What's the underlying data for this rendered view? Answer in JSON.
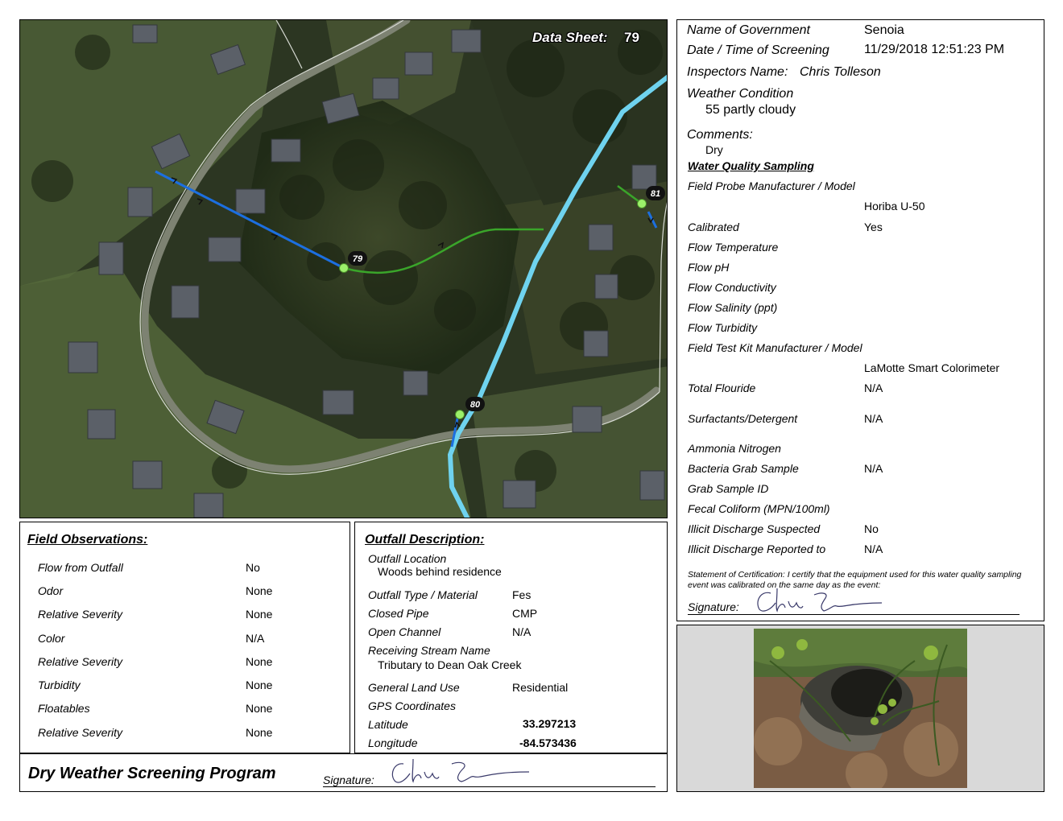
{
  "map": {
    "data_sheet_label": "Data Sheet:",
    "data_sheet_number": "79",
    "markers": [
      {
        "id": "79"
      },
      {
        "id": "80"
      },
      {
        "id": "81"
      }
    ],
    "colors": {
      "pipe": "#1c6fe0",
      "stream": "#6fd3ef",
      "channel": "#3aa52a",
      "outfall": "#9cf06a",
      "road": "#c9ccc6"
    }
  },
  "info": {
    "gov_label": "Name of Government",
    "gov_value": "Senoia",
    "date_label": "Date / Time of Screening",
    "date_value": "11/29/2018 12:51:23 PM",
    "inspectors_label": "Inspectors Name:",
    "inspectors_value": "Chris Tolleson",
    "weather_label": "Weather Condition",
    "weather_value": "55 partly cloudy",
    "comments_label": "Comments:",
    "comments_value": "Dry",
    "wq_title": "Water Quality Sampling",
    "probe_label": "Field Probe Manufacturer / Model",
    "probe_value": "Horiba U-50",
    "calibrated_label": "Calibrated",
    "calibrated_value": "Yes",
    "temp_label": "Flow Temperature",
    "ph_label": "Flow pH",
    "cond_label": "Flow Conductivity",
    "sal_label": "Flow Salinity (ppt)",
    "turb_label": "Flow Turbidity",
    "kit_label": "Field Test Kit Manufacturer / Model",
    "kit_value": "LaMotte Smart Colorimeter",
    "fluoride_label": "Total Flouride",
    "fluoride_value": "N/A",
    "surf_label": "Surfactants/Detergent",
    "surf_value": "N/A",
    "ammonia_label": "Ammonia Nitrogen",
    "bact_label": "Bacteria Grab Sample",
    "bact_value": "N/A",
    "grab_label": "Grab Sample ID",
    "fecal_label": "Fecal Coliform (MPN/100ml)",
    "suspected_label": "Illicit Discharge Suspected",
    "suspected_value": "No",
    "reported_label": "Illicit Discharge Reported to",
    "reported_value": "N/A",
    "certification": "Statement of Certification: I certify that the equipment used for this water quality sampling event was calibrated on the same day as the event:",
    "signature_label": "Signature:"
  },
  "field": {
    "title": "Field Observations:",
    "rows": [
      {
        "label": "Flow from Outfall",
        "value": "No"
      },
      {
        "label": "Odor",
        "value": "None"
      },
      {
        "label": "Relative Severity",
        "value": "None"
      },
      {
        "label": "Color",
        "value": "N/A"
      },
      {
        "label": "Relative Severity",
        "value": "None"
      },
      {
        "label": "Turbidity",
        "value": "None"
      },
      {
        "label": "Floatables",
        "value": "None"
      },
      {
        "label": "Relative Severity",
        "value": "None"
      }
    ]
  },
  "outfall": {
    "title": "Outfall Description:",
    "location_label": "Outfall Location",
    "location_value": "Woods behind residence",
    "type_label": "Outfall Type / Material",
    "type_value": "Fes",
    "closed_label": "Closed Pipe",
    "closed_value": "CMP",
    "open_label": "Open Channel",
    "open_value": "N/A",
    "stream_label": "Receiving Stream Name",
    "stream_value": "Tributary to Dean Oak Creek",
    "land_label": "General Land Use",
    "land_value": "Residential",
    "gps_label": "GPS Coordinates",
    "lat_label": "Latitude",
    "lat_value": "33.297213",
    "lon_label": "Longitude",
    "lon_value": "-84.573436"
  },
  "footer": {
    "program": "Dry Weather Screening Program",
    "signature_label": "Signature:"
  }
}
